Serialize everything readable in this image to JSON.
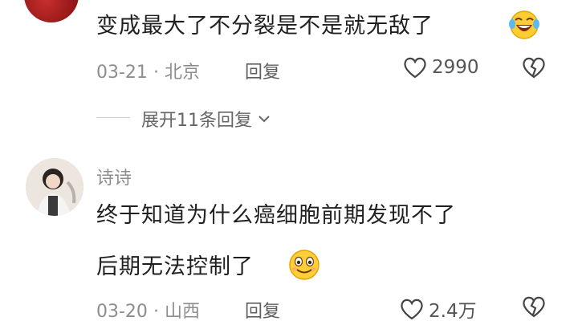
{
  "comment1": {
    "text": "变成最大了不分裂是不是就无敌了",
    "date": "03-21",
    "dot": "·",
    "location": "北京",
    "reply_label": "回复",
    "likes": "2990",
    "emoji": "laughing-crying-emoji"
  },
  "expand_replies": {
    "label": "展开11条回复"
  },
  "comment2": {
    "username": "诗诗",
    "line1": "终于知道为什么癌细胞前期发现不了",
    "line2": "后期无法控制了",
    "date": "03-20",
    "dot": "·",
    "location": "山西",
    "reply_label": "回复",
    "likes": "2.4万",
    "emoji": "smile-emoji"
  }
}
